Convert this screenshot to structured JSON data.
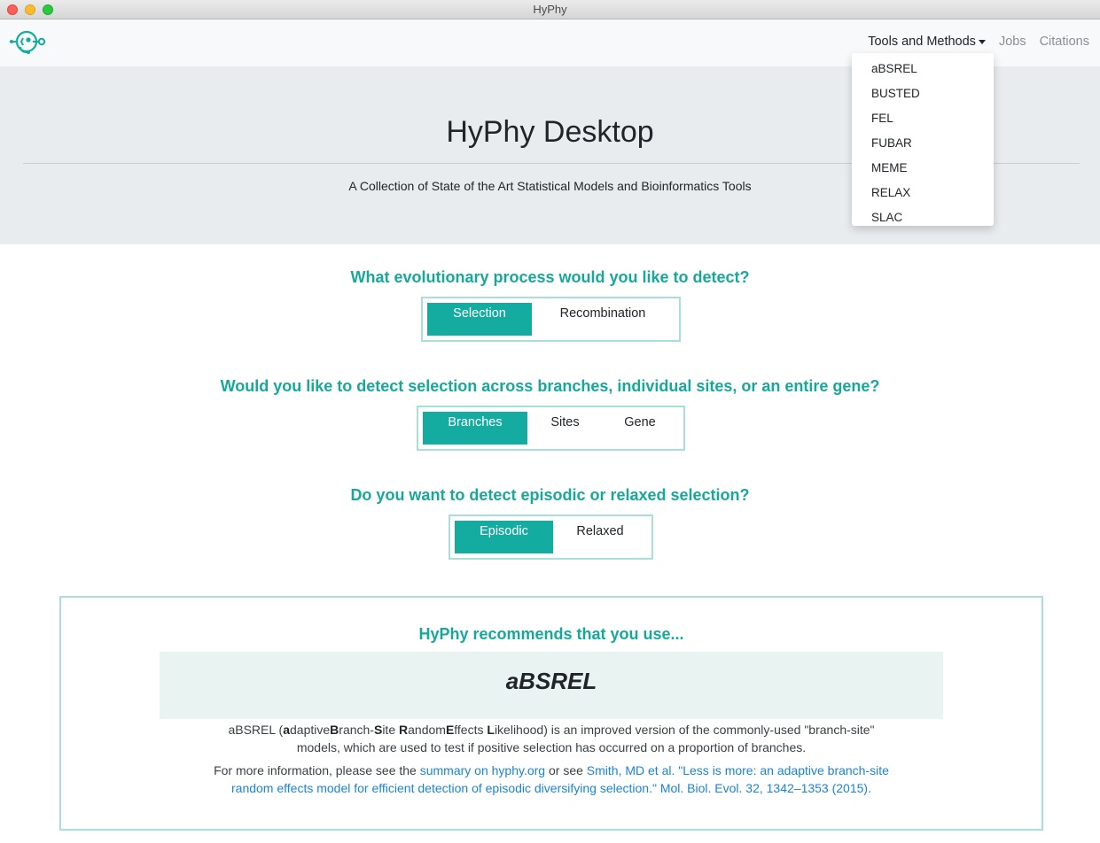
{
  "window": {
    "title": "HyPhy"
  },
  "navbar": {
    "logo_icon": "hyphy-logo-icon",
    "tools_label": "Tools and Methods",
    "jobs_label": "Jobs",
    "citations_label": "Citations"
  },
  "dropdown": {
    "items": [
      "aBSREL",
      "BUSTED",
      "FEL",
      "FUBAR",
      "MEME",
      "RELAX",
      "SLAC"
    ]
  },
  "jumbotron": {
    "title": "HyPhy Desktop",
    "subtitle": "A Collection of State of the Art Statistical Models and Bioinformatics Tools"
  },
  "questions": {
    "q1": {
      "text": "What evolutionary process would you like to detect?",
      "options": [
        "Selection",
        "Recombination"
      ],
      "selected": "Selection"
    },
    "q2": {
      "text": "Would you like to detect selection across branches, individual sites, or an entire gene?",
      "options": [
        "Branches",
        "Sites",
        "Gene"
      ],
      "selected": "Branches"
    },
    "q3": {
      "text": "Do you want to detect episodic or relaxed selection?",
      "options": [
        "Episodic",
        "Relaxed"
      ],
      "selected": "Episodic"
    }
  },
  "recommendation": {
    "title": "HyPhy recommends that you use...",
    "method": "aBSREL",
    "desc_open": "aBSREL (",
    "desc_a": "a",
    "desc_adaptive": "daptive",
    "desc_b": "B",
    "desc_branch": "ranch-",
    "desc_s": "S",
    "desc_site": "ite ",
    "desc_r": "R",
    "desc_random": "andom",
    "desc_e": "E",
    "desc_effects": "ffects ",
    "desc_l": "L",
    "desc_rest_line1": "ikelihood) is an improved version of the commonly-used \"branch-site\"",
    "desc_line2": "models, which are used to test if positive selection has occurred on a proportion of branches.",
    "more_prefix": "For more information, please see the ",
    "more_link1": "summary on hyphy.org",
    "more_middle": " or see ",
    "more_link2_line1": "Smith, MD et al. \"Less is more: an adaptive branch-site",
    "more_link2_line2": "random effects model for efficient detection of episodic diversifying selection.\" Mol. Biol. Evol. 32, 1342–1353 (2015)."
  },
  "colors": {
    "accent": "#14aca0",
    "heading": "#17a89a",
    "link": "#1a84d6",
    "jumbotron_bg": "#e9ecef"
  }
}
